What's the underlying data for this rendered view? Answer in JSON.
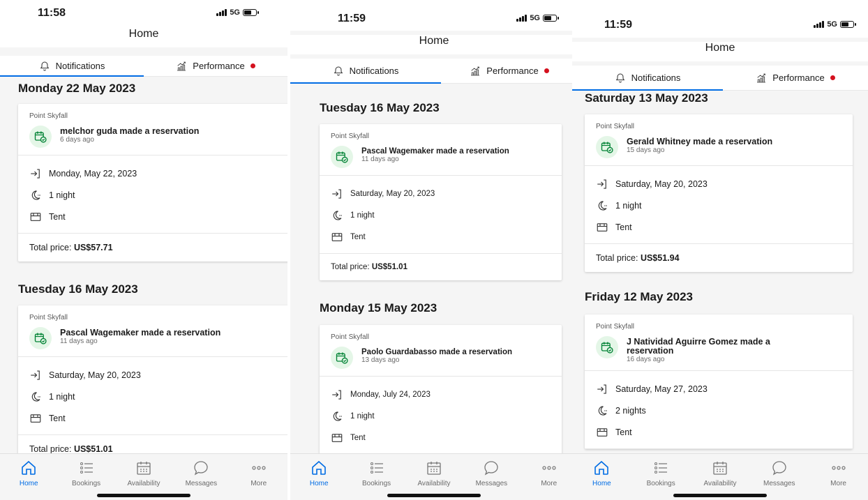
{
  "header": {
    "title": "Home"
  },
  "tabs": {
    "notifications": "Notifications",
    "performance": "Performance"
  },
  "labels": {
    "total_price": "Total price:"
  },
  "nav": [
    {
      "label": "Home",
      "icon": "home-icon"
    },
    {
      "label": "Bookings",
      "icon": "list-icon"
    },
    {
      "label": "Availability",
      "icon": "calendar-icon"
    },
    {
      "label": "Messages",
      "icon": "chat-icon"
    },
    {
      "label": "More",
      "icon": "more-icon"
    }
  ],
  "colors": {
    "accent": "#006ce4",
    "alert_dot": "#d4111e",
    "reservation_bubble": "#e4f6e7",
    "reservation_icon": "#008234"
  },
  "screens": [
    {
      "time": "11:58",
      "network": "5G",
      "groups": [
        {
          "date": "Monday 22 May 2023",
          "card": {
            "property": "Point Skyfall",
            "title": "melchor guda made a reservation",
            "ago": "6 days ago",
            "checkin": "Monday, May 22, 2023",
            "nights": "1 night",
            "room": "Tent",
            "price": "US$57.71"
          }
        },
        {
          "date": "Tuesday 16 May 2023",
          "card": {
            "property": "Point Skyfall",
            "title": "Pascal Wagemaker made a reservation",
            "ago": "11 days ago",
            "checkin": "Saturday, May 20, 2023",
            "nights": "1 night",
            "room": "Tent",
            "price": "US$51.01"
          }
        }
      ]
    },
    {
      "time": "11:59",
      "network": "5G",
      "groups": [
        {
          "date": "Tuesday 16 May 2023",
          "card": {
            "property": "Point Skyfall",
            "title": "Pascal Wagemaker made a reservation",
            "ago": "11 days ago",
            "checkin": "Saturday, May 20, 2023",
            "nights": "1 night",
            "room": "Tent",
            "price": "US$51.01"
          }
        },
        {
          "date": "Monday 15 May 2023",
          "card": {
            "property": "Point Skyfall",
            "title": "Paolo Guardabasso made a reservation",
            "ago": "13 days ago",
            "checkin": "Monday, July 24, 2023",
            "nights": "1 night",
            "room": "Tent",
            "price": ""
          }
        }
      ]
    },
    {
      "time": "11:59",
      "network": "5G",
      "groups": [
        {
          "date": "Saturday 13 May 2023",
          "card": {
            "property": "Point Skyfall",
            "title": "Gerald Whitney made a reservation",
            "ago": "15 days ago",
            "checkin": "Saturday, May 20, 2023",
            "nights": "1 night",
            "room": "Tent",
            "price": "US$51.94"
          }
        },
        {
          "date": "Friday 12 May 2023",
          "card": {
            "property": "Point Skyfall",
            "title": "J Natividad Aguirre Gomez made a reservation",
            "ago": "16 days ago",
            "checkin": "Saturday, May 27, 2023",
            "nights": "2 nights",
            "room": "Tent",
            "price": ""
          }
        }
      ]
    }
  ]
}
